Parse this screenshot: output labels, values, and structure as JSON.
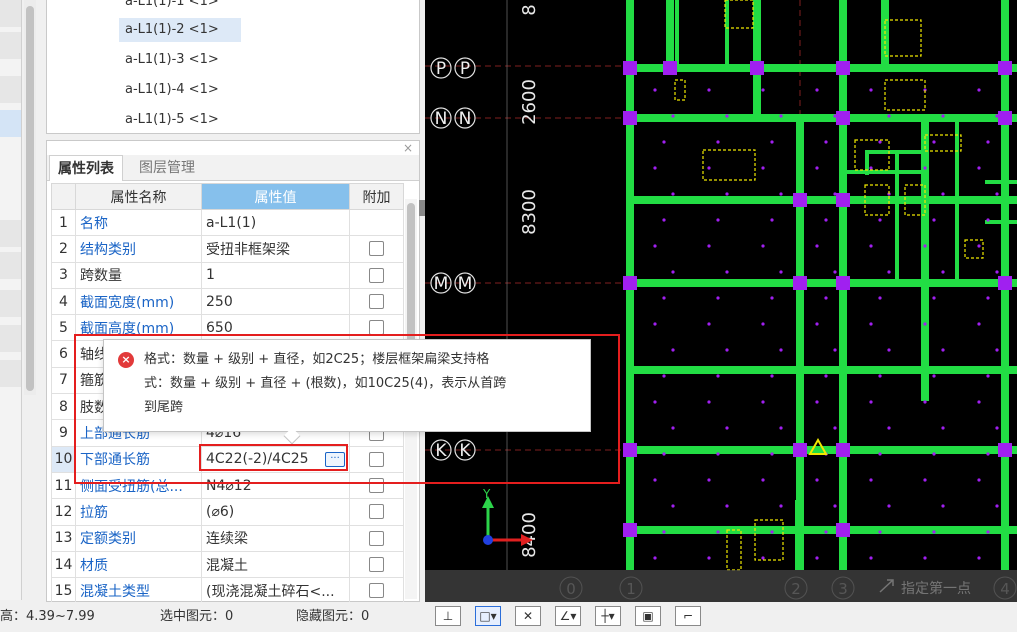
{
  "list": {
    "items": [
      "a-L1(1)-1 <1>",
      "a-L1(1)-2 <1>",
      "a-L1(1)-3 <1>",
      "a-L1(1)-4 <1>",
      "a-L1(1)-5 <1>"
    ],
    "selected_index": 1
  },
  "panel": {
    "close_glyph": "×",
    "tabs": [
      "属性列表",
      "图层管理"
    ],
    "headers": {
      "name": "属性名称",
      "value": "属性值",
      "extra": "附加"
    }
  },
  "properties": [
    {
      "num": "1",
      "name": "名称",
      "value": "a-L1(1)",
      "checkbox": false
    },
    {
      "num": "2",
      "name": "结构类别",
      "value": "受扭非框架梁",
      "checkbox": true
    },
    {
      "num": "3",
      "name": "跨数量",
      "value": "1",
      "checkbox": true
    },
    {
      "num": "4",
      "name": "截面宽度(mm)",
      "value": "250",
      "checkbox": true
    },
    {
      "num": "5",
      "name": "截面高度(mm)",
      "value": "650",
      "checkbox": true
    },
    {
      "num": "6",
      "name": "轴线",
      "value": "",
      "checkbox": true
    },
    {
      "num": "7",
      "name": "箍筋",
      "value": "",
      "checkbox": true
    },
    {
      "num": "8",
      "name": "肢数",
      "value": "",
      "checkbox": true
    },
    {
      "num": "9",
      "name": "上部通长筋",
      "value": "4⌀16",
      "checkbox": true
    },
    {
      "num": "10",
      "name": "下部通长筋",
      "value": "4C22(-2)/4C25",
      "checkbox": true
    },
    {
      "num": "11",
      "name": "侧面受扭筋(总...",
      "value": "N4⌀12",
      "checkbox": true
    },
    {
      "num": "12",
      "name": "拉筋",
      "value": "(⌀6)",
      "checkbox": true
    },
    {
      "num": "13",
      "name": "定额类别",
      "value": "连续梁",
      "checkbox": true
    },
    {
      "num": "14",
      "name": "材质",
      "value": "混凝土",
      "checkbox": true
    },
    {
      "num": "15",
      "name": "混凝土类型",
      "value": "(现浇混凝土碎石<...",
      "checkbox": true
    }
  ],
  "tooltip": {
    "icon": "×",
    "line1": "格式：数量 + 级别 + 直径，如2C25；楼层框架扁梁支持格",
    "line2": "式：数量 + 级别 + 直径 + (根数)，如10C25(4)，表示从首跨",
    "line3": "到尾跨"
  },
  "edit_button": "···",
  "status": {
    "height": "高：4.39~7.99",
    "selected": "选中图元：0",
    "hidden": "隐藏图元：0"
  },
  "canvas": {
    "axis_labels": [
      "P",
      "N",
      "M",
      "K"
    ],
    "dims": [
      "8",
      "2600",
      "8300",
      "8400"
    ],
    "bottom_axes": [
      "0",
      "1",
      "2",
      "3",
      "4"
    ],
    "hint": "指定第一点",
    "ucs_y": "Y",
    "colors": {
      "beam": "#22dd44",
      "column": "#a020f0",
      "annotation": "#f0e800",
      "background": "#000000"
    }
  },
  "snap_tools": [
    "⊥",
    "□▾",
    "✕",
    "∠▾",
    "┼▾",
    "▣",
    "⌐"
  ]
}
